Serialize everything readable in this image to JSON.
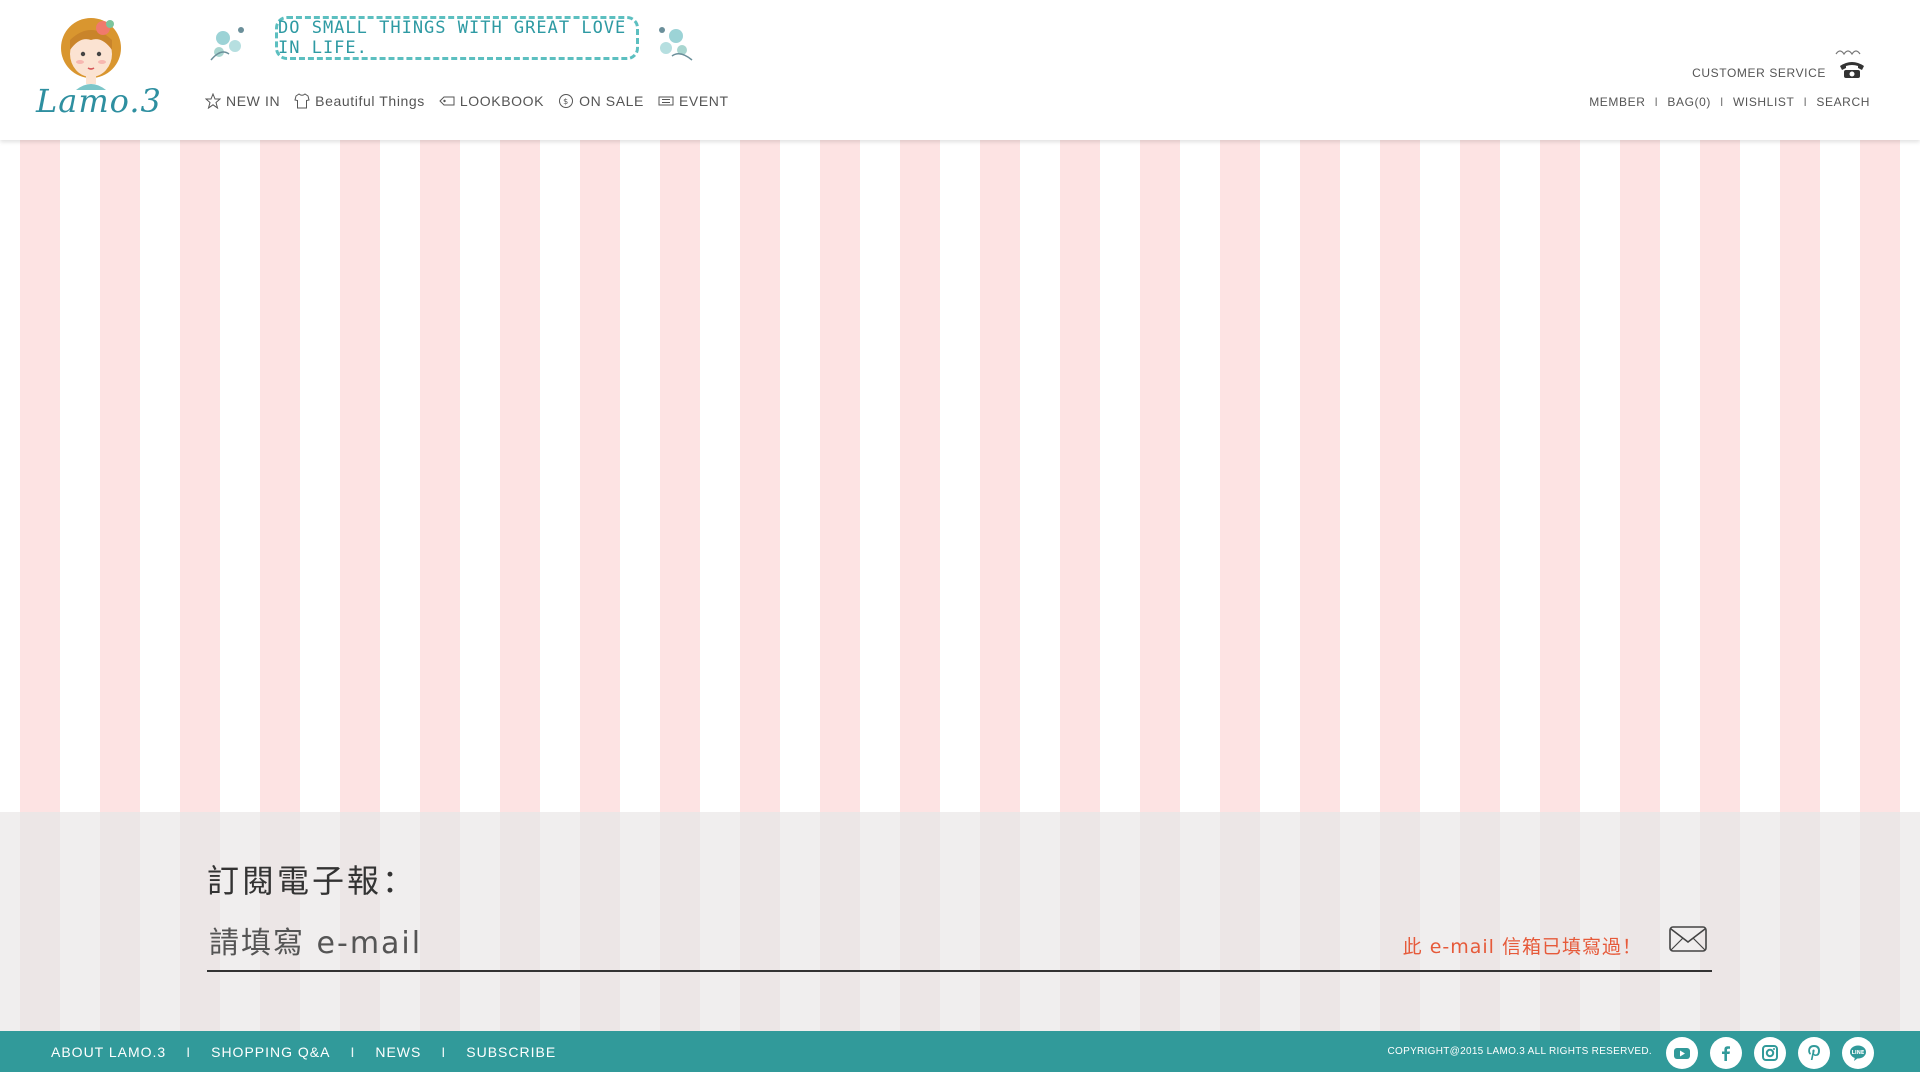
{
  "header": {
    "logo_text": "Lamo.3",
    "tagline": "DO SMALL THINGS WITH GREAT LOVE IN LIFE.",
    "nav": [
      {
        "label": "NEW IN",
        "icon": "star-icon"
      },
      {
        "label": "Beautiful Things",
        "icon": "shirt-icon"
      },
      {
        "label": "LOOKBOOK",
        "icon": "tag-icon"
      },
      {
        "label": "ON SALE",
        "icon": "discount-icon"
      },
      {
        "label": "EVENT",
        "icon": "ticket-icon"
      }
    ],
    "customer_service": "CUSTOMER SERVICE",
    "account": {
      "member": "MEMBER",
      "bag": "BAG(0)",
      "wishlist": "WISHLIST",
      "search": "SEARCH",
      "separator": "I"
    }
  },
  "subscribe": {
    "title": "訂閱電子報：",
    "email_placeholder": "請填寫 e-mail",
    "error": "此 e-mail 信箱已填寫過！"
  },
  "footer": {
    "links": [
      "ABOUT LAMO.3",
      "SHOPPING Q&A",
      "NEWS",
      "SUBSCRIBE"
    ],
    "separator": "I",
    "copyright": "COPYRIGHT@2015 LAMO.3 ALL RIGHTS RESERVED.",
    "socials": [
      "youtube-icon",
      "facebook-icon",
      "instagram-icon",
      "pinterest-icon",
      "line-icon"
    ]
  },
  "colors": {
    "accent": "#319a9a",
    "stripe_pink": "#fde3e3",
    "error_red": "#e65a3a"
  }
}
